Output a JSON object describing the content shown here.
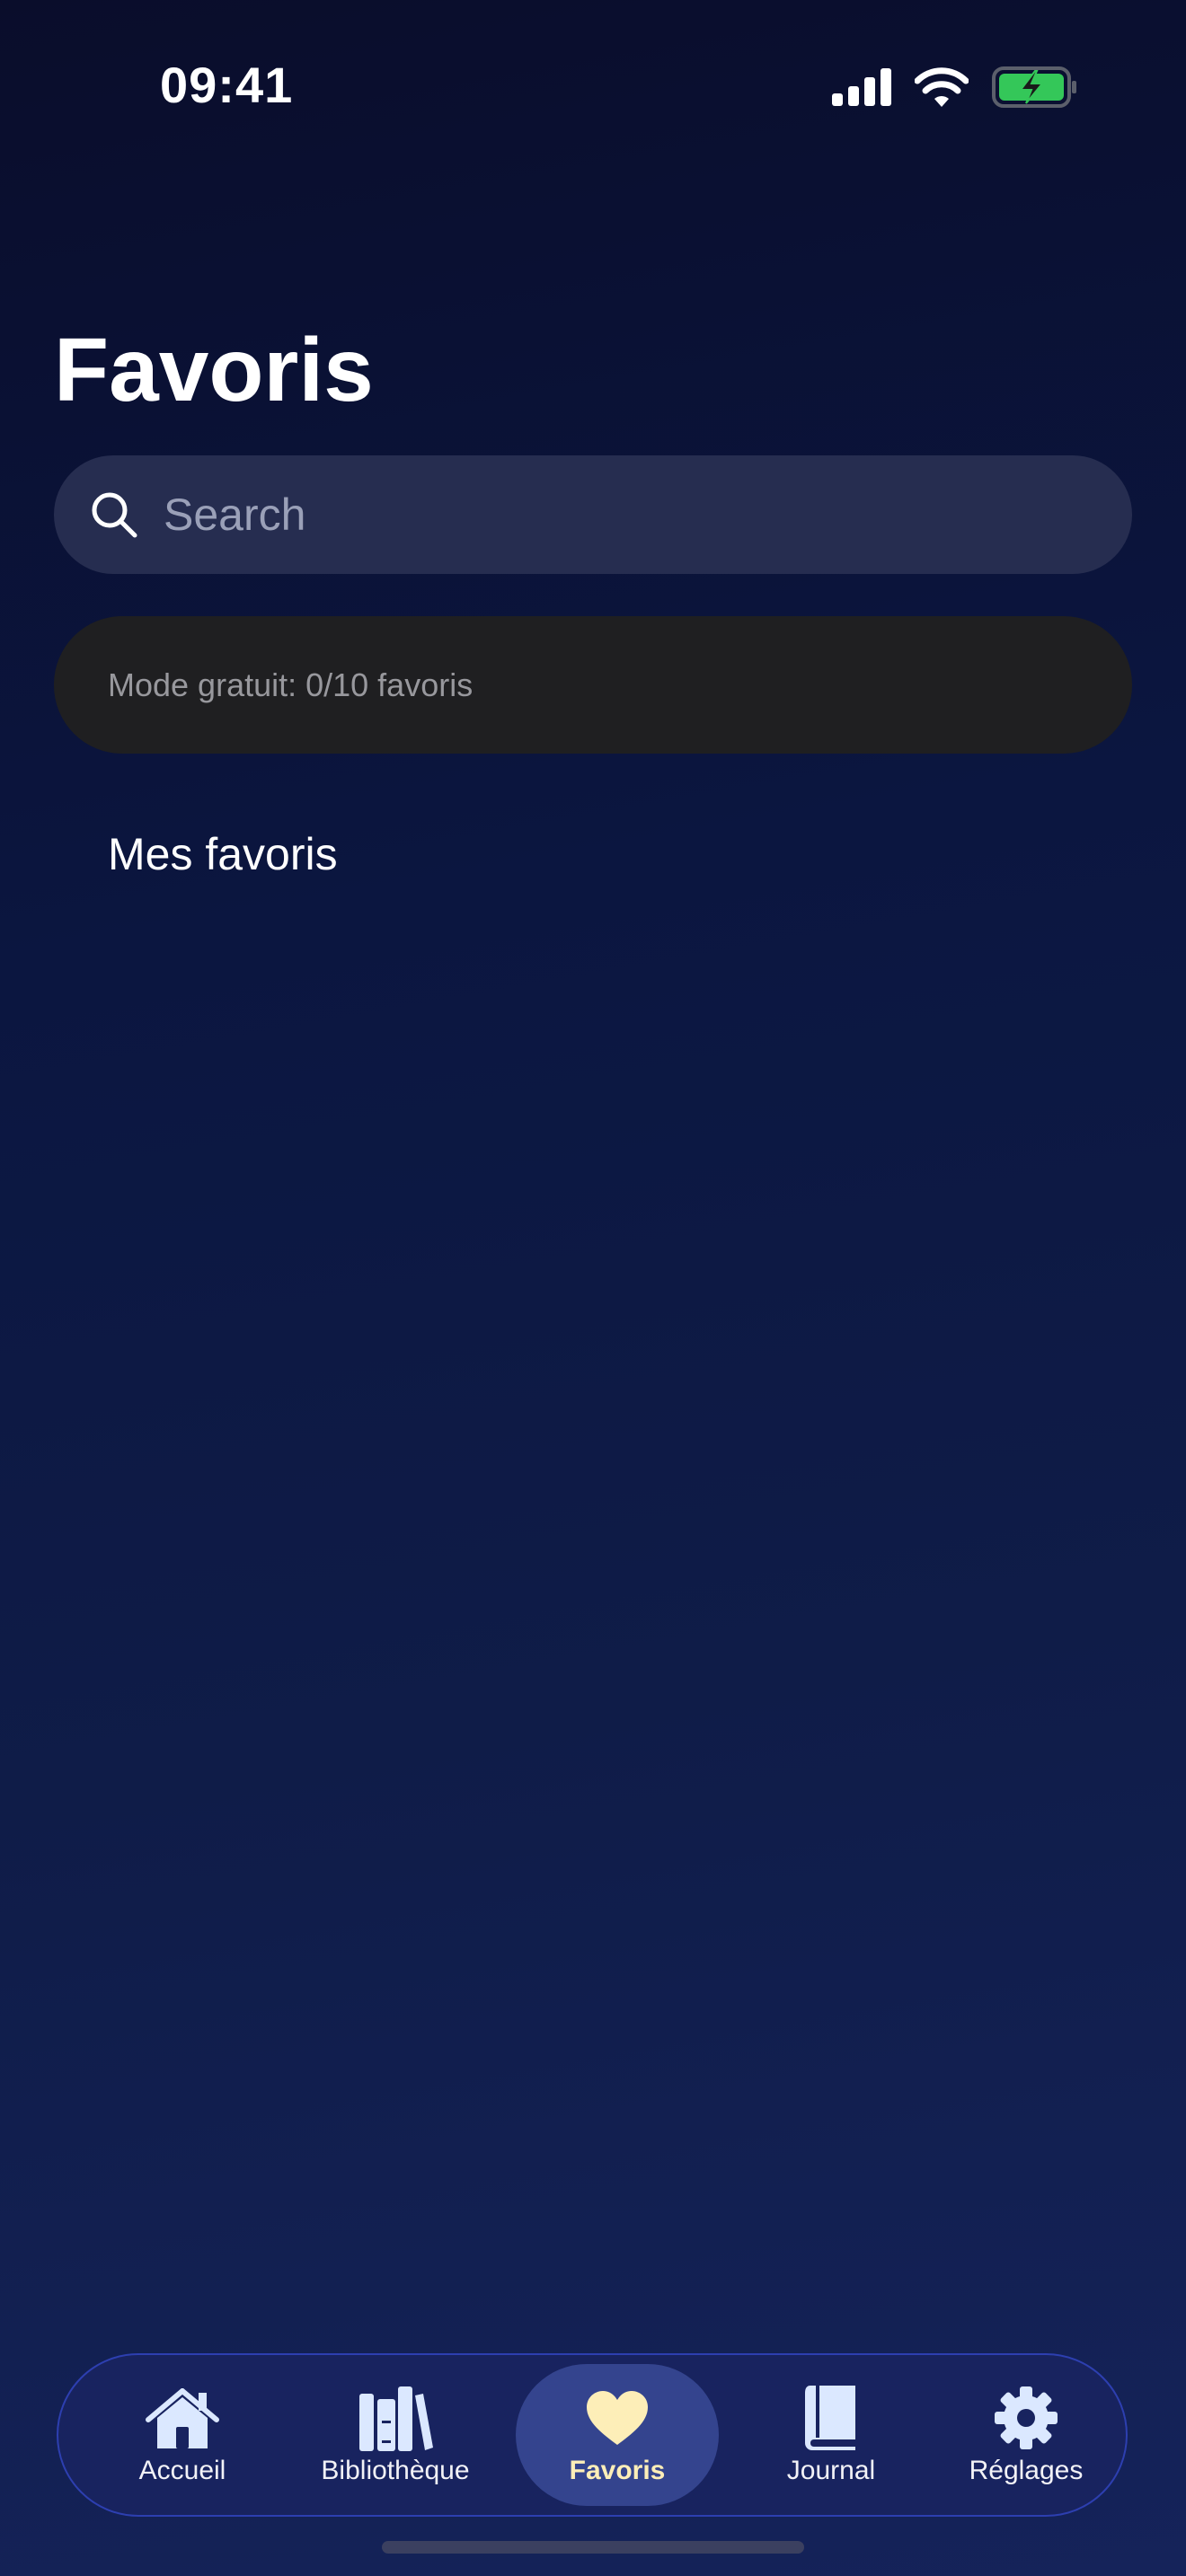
{
  "status_bar": {
    "time": "09:41",
    "icons": [
      "cellular-signal-icon",
      "wifi-icon",
      "battery-charging-icon"
    ]
  },
  "page": {
    "title": "Favoris"
  },
  "search": {
    "placeholder": "Search",
    "value": ""
  },
  "free_mode": {
    "text": "Mode gratuit: 0/10 favoris",
    "used": 0,
    "limit": 10
  },
  "favorites_section": {
    "title": "Mes favoris",
    "items": []
  },
  "tab_bar": {
    "items": [
      {
        "label": "Accueil",
        "icon": "home-icon",
        "active": false
      },
      {
        "label": "Bibliothèque",
        "icon": "books-icon",
        "active": false
      },
      {
        "label": "Favoris",
        "icon": "heart-icon",
        "active": true
      },
      {
        "label": "Journal",
        "icon": "book-icon",
        "active": false
      },
      {
        "label": "Réglages",
        "icon": "gear-icon",
        "active": false
      }
    ]
  },
  "colors": {
    "accent_active": "#fdeeb8",
    "tab_bar_background": "#18235f",
    "tab_bar_border": "#2d3fb0",
    "battery_fill": "#34c759"
  }
}
